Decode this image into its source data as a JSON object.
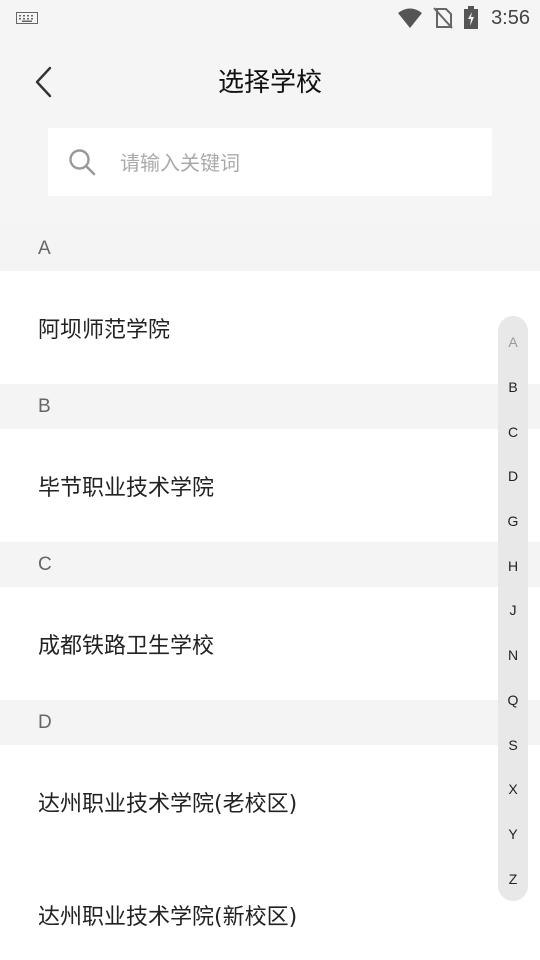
{
  "status_bar": {
    "time": "3:56",
    "icons": [
      "keyboard-icon",
      "wifi-icon",
      "no-sim-icon",
      "battery-charging-icon"
    ]
  },
  "header": {
    "title": "选择学校",
    "back_icon": "chevron-left-icon"
  },
  "search": {
    "placeholder": "请输入关键词",
    "value": "",
    "icon": "search-icon"
  },
  "sections": [
    {
      "letter": "A",
      "items": [
        "阿坝师范学院"
      ]
    },
    {
      "letter": "B",
      "items": [
        "毕节职业技术学院"
      ]
    },
    {
      "letter": "C",
      "items": [
        "成都铁路卫生学校"
      ]
    },
    {
      "letter": "D",
      "items": [
        "达州职业技术学院(老校区)",
        "达州职业技术学院(新校区)"
      ]
    }
  ],
  "alpha_index": [
    "A",
    "B",
    "C",
    "D",
    "G",
    "H",
    "J",
    "N",
    "Q",
    "S",
    "X",
    "Y",
    "Z"
  ],
  "colors": {
    "background": "#f5f5f5",
    "section_header": "#f4f4f4",
    "index_bar": "#e8e8e8"
  }
}
